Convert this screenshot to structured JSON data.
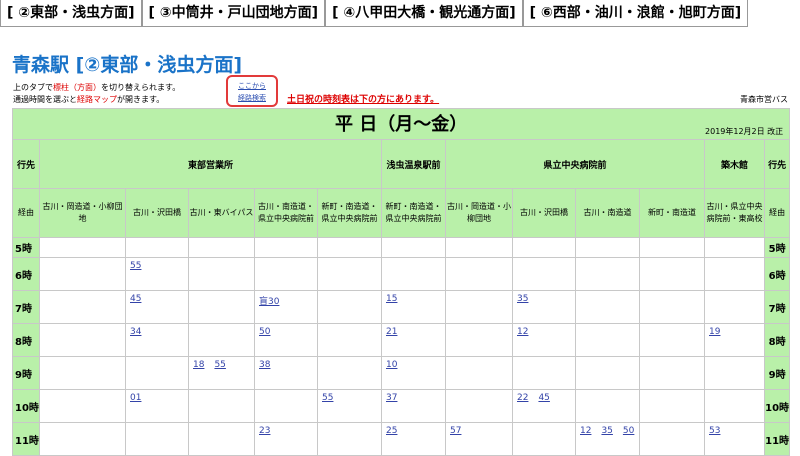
{
  "tabs": [
    "[ ②東部・浅虫方面]",
    "[ ③中筒井・戸山団地方面]",
    "[ ④八甲田大橋・観光通方面]",
    "[ ⑥西部・油川・浪館・旭町方面]"
  ],
  "page_title": "青森駅 [②東部・浅虫方面]",
  "hint_line1_a": "上のタブで",
  "hint_line1_red": "標柱（方面）",
  "hint_line1_b": "を切り替えられます。",
  "hint_line2_a": "通過時間を選ぶと",
  "hint_line2_red": "経路マップ",
  "hint_line2_b": "が開きます。",
  "route_search": {
    "line1": "ここから",
    "line2": "経路検索"
  },
  "holiday_note": "土日祝の時刻表は下の方にあります。",
  "operator": "青森市営バス",
  "day_title": "平 日（月～金）",
  "revised": "2019年12月2日 改正",
  "dest_label": "行先",
  "via_label": "経由",
  "destinations": [
    "東部営業所",
    "浅虫温泉駅前",
    "県立中央病院前",
    "築木館"
  ],
  "vias": [
    "古川・岡造道・小柳団地",
    "古川・沢田橋",
    "古川・東バイパス",
    "古川・南造道・県立中央病院前",
    "新町・南造道・県立中央病院前",
    "新町・南造道・県立中央病院前",
    "古川・岡造道・小柳団地",
    "古川・沢田橋",
    "古川・南造道",
    "新町・南造道",
    "古川・県立中央病院前・東高校"
  ],
  "rows": [
    {
      "hour": "5時",
      "cells": [
        [],
        [],
        [],
        [],
        [],
        [],
        [],
        [],
        [],
        [],
        []
      ]
    },
    {
      "hour": "6時",
      "cells": [
        [],
        [
          "55"
        ],
        [],
        [],
        [],
        [],
        [],
        [],
        [],
        [],
        []
      ]
    },
    {
      "hour": "7時",
      "cells": [
        [],
        [
          "45"
        ],
        [],
        [
          "盲30"
        ],
        [],
        [
          "15"
        ],
        [],
        [
          "35"
        ],
        [],
        [],
        []
      ]
    },
    {
      "hour": "8時",
      "cells": [
        [],
        [
          "34"
        ],
        [],
        [
          "50"
        ],
        [],
        [
          "21"
        ],
        [],
        [
          "12"
        ],
        [],
        [],
        [
          "19"
        ]
      ]
    },
    {
      "hour": "9時",
      "cells": [
        [],
        [],
        [
          "18",
          "55"
        ],
        [
          "38"
        ],
        [],
        [
          "10"
        ],
        [],
        [],
        [],
        [],
        []
      ]
    },
    {
      "hour": "10時",
      "cells": [
        [],
        [
          "01"
        ],
        [],
        [],
        [
          "55"
        ],
        [
          "37"
        ],
        [],
        [
          "22",
          "45"
        ],
        [],
        [],
        []
      ]
    },
    {
      "hour": "11時",
      "cells": [
        [],
        [],
        [],
        [
          "23"
        ],
        [],
        [
          "25"
        ],
        [
          "57"
        ],
        [],
        [
          "12",
          "35",
          "50"
        ],
        [],
        [
          "53"
        ]
      ]
    }
  ]
}
